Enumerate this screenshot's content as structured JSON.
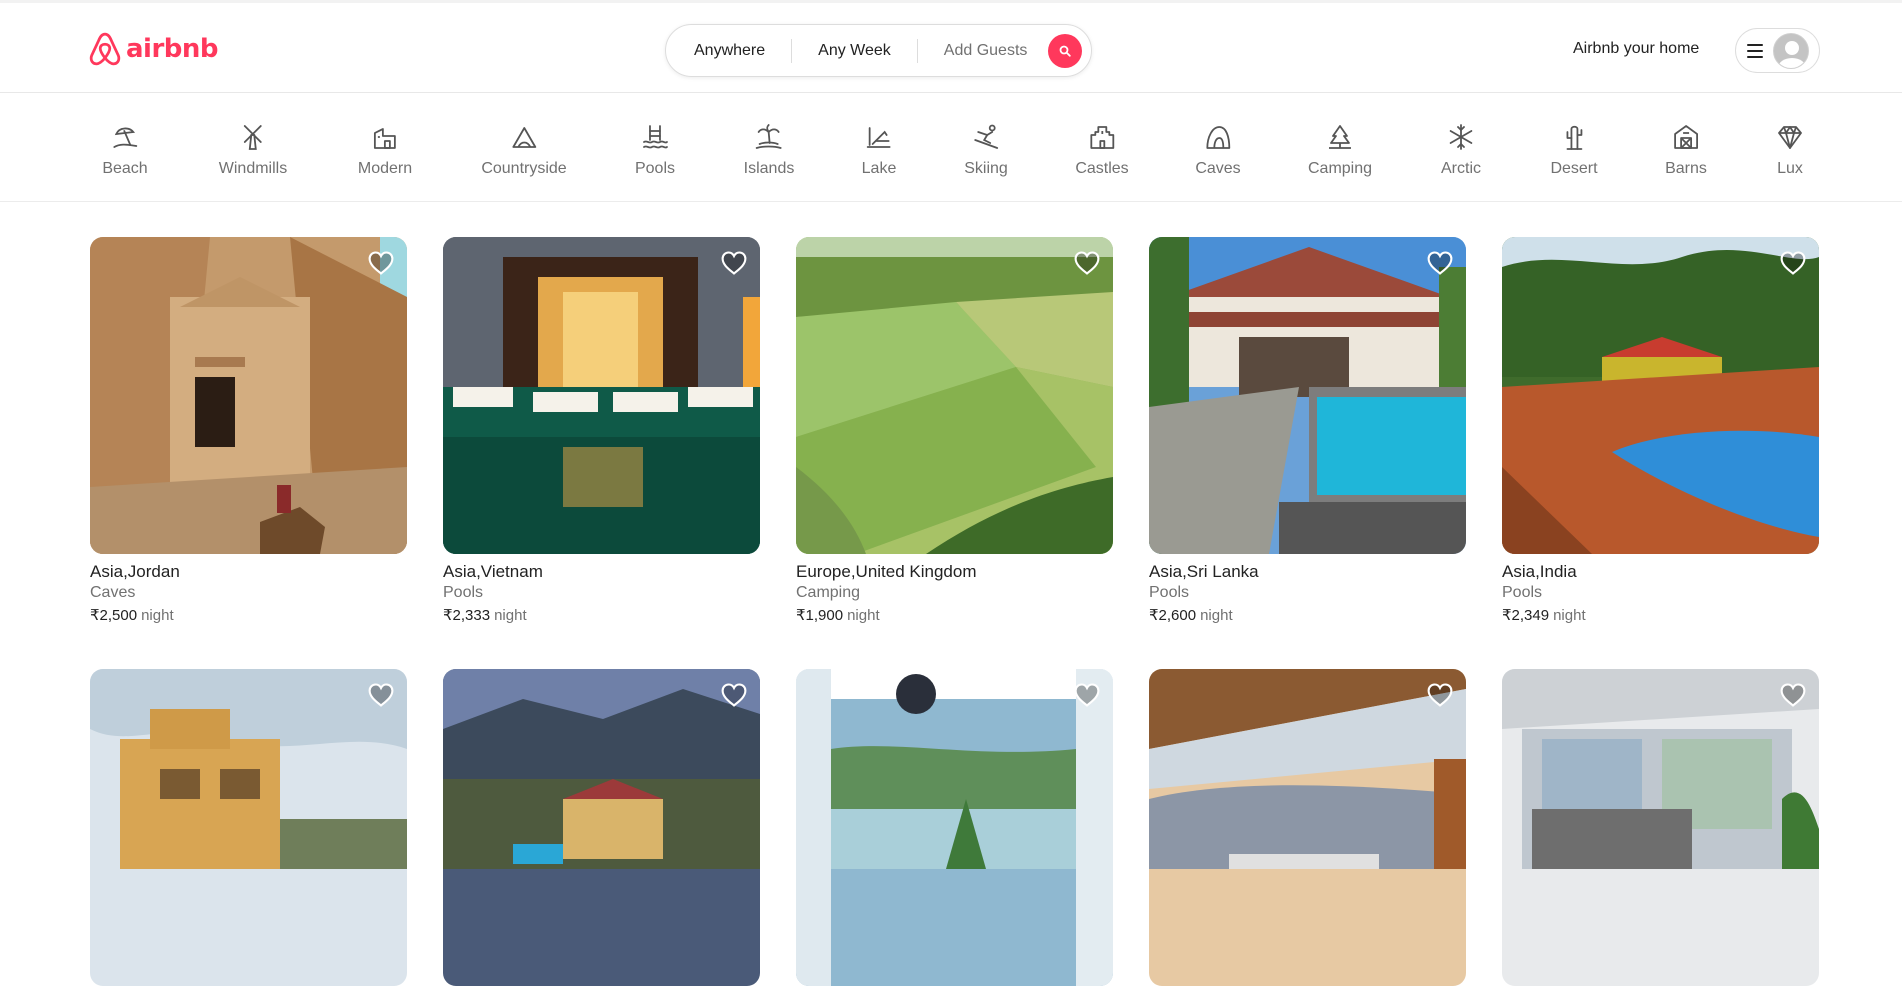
{
  "header": {
    "logo_text": "airbnb",
    "search": {
      "location": "Anywhere",
      "week": "Any Week",
      "guests": "Add Guests"
    },
    "host_link": "Airbnb your home"
  },
  "categories": [
    {
      "label": "Beach",
      "icon": "beach-icon"
    },
    {
      "label": "Windmills",
      "icon": "windmill-icon"
    },
    {
      "label": "Modern",
      "icon": "modern-house-icon"
    },
    {
      "label": "Countryside",
      "icon": "countryside-icon"
    },
    {
      "label": "Pools",
      "icon": "pool-icon"
    },
    {
      "label": "Islands",
      "icon": "island-icon"
    },
    {
      "label": "Lake",
      "icon": "lake-icon"
    },
    {
      "label": "Skiing",
      "icon": "skiing-icon"
    },
    {
      "label": "Castles",
      "icon": "castle-icon"
    },
    {
      "label": "Caves",
      "icon": "cave-icon"
    },
    {
      "label": "Camping",
      "icon": "camping-icon"
    },
    {
      "label": "Arctic",
      "icon": "snowflake-icon"
    },
    {
      "label": "Desert",
      "icon": "cactus-icon"
    },
    {
      "label": "Barns",
      "icon": "barn-icon"
    },
    {
      "label": "Lux",
      "icon": "diamond-icon"
    }
  ],
  "listings": [
    {
      "title": "Asia,Jordan",
      "category": "Caves",
      "price": "₹2,500",
      "unit": "night"
    },
    {
      "title": "Asia,Vietnam",
      "category": "Pools",
      "price": "₹2,333",
      "unit": "night"
    },
    {
      "title": "Europe,United Kingdom",
      "category": "Camping",
      "price": "₹1,900",
      "unit": "night"
    },
    {
      "title": "Asia,Sri Lanka",
      "category": "Pools",
      "price": "₹2,600",
      "unit": "night"
    },
    {
      "title": "Asia,India",
      "category": "Pools",
      "price": "₹2,349",
      "unit": "night"
    },
    {
      "title": "",
      "category": "",
      "price": "",
      "unit": ""
    },
    {
      "title": "",
      "category": "",
      "price": "",
      "unit": ""
    },
    {
      "title": "",
      "category": "",
      "price": "",
      "unit": ""
    },
    {
      "title": "",
      "category": "",
      "price": "",
      "unit": ""
    },
    {
      "title": "",
      "category": "",
      "price": "",
      "unit": ""
    }
  ],
  "colors": {
    "brand": "#ff385c",
    "text": "#222222",
    "muted": "#717171",
    "border": "#dddddd"
  }
}
